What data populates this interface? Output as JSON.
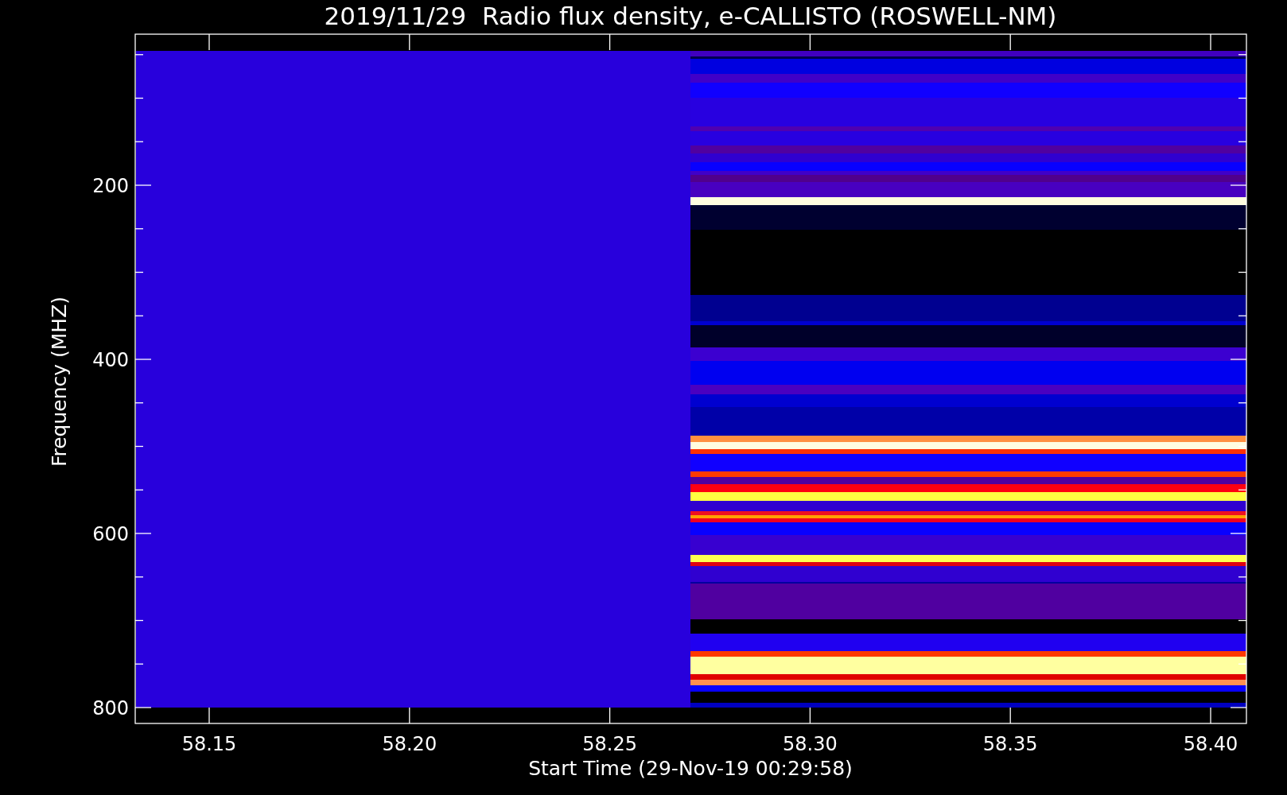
{
  "plot": {
    "title": "2019/11/29  Radio flux density, e-CALLISTO (ROSWELL-NM)",
    "x_axis": {
      "label": "Start Time (29-Nov-19 00:29:58)",
      "ticks": [
        "58.15",
        "58.20",
        "58.25",
        "58.30",
        "58.35",
        "58.40"
      ]
    },
    "y_axis": {
      "label": "Frequency (MHZ)",
      "ticks": [
        "200",
        "400",
        "600",
        "800"
      ]
    }
  }
}
